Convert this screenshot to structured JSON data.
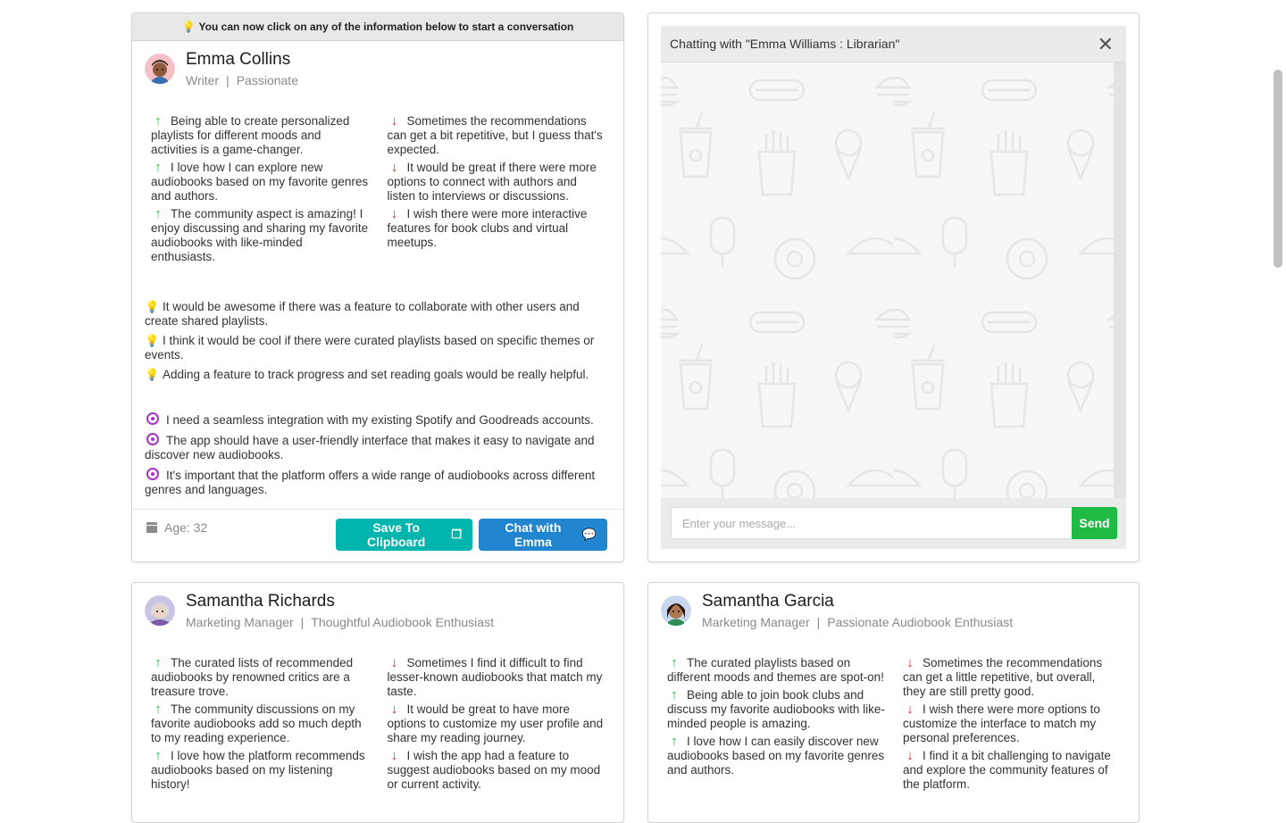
{
  "notice": "You can now click on any of the information below to start a conversation",
  "personas": [
    {
      "name": "Emma Collins",
      "role": "Writer",
      "trait": "Passionate",
      "likes": [
        "Being able to create personalized playlists for different moods and activities is a game-changer.",
        "I love how I can explore new audiobooks based on my favorite genres and authors.",
        "The community aspect is amazing! I enjoy discussing and sharing my favorite audiobooks with like-minded enthusiasts."
      ],
      "dislikes": [
        "Sometimes the recommendations can get a bit repetitive, but I guess that's expected.",
        "It would be great if there were more options to connect with authors and listen to interviews or discussions.",
        "I wish there were more interactive features for book clubs and virtual meetups."
      ],
      "suggestions": [
        "It would be awesome if there was a feature to collaborate with other users and create shared playlists.",
        "I think it would be cool if there were curated playlists based on specific themes or events.",
        "Adding a feature to track progress and set reading goals would be really helpful."
      ],
      "goals": [
        "I need a seamless integration with my existing Spotify and Goodreads accounts.",
        "The app should have a user-friendly interface that makes it easy to navigate and discover new audiobooks.",
        "It's important that the platform offers a wide range of audiobooks across different genres and languages."
      ],
      "age": "Age: 32",
      "copy_label": "Save To Clipboard",
      "chat_label": "Chat with Emma"
    },
    {
      "name": "Samantha Richards",
      "role": "Marketing Manager",
      "trait": "Thoughtful Audiobook Enthusiast",
      "likes": [
        "The curated lists of recommended audiobooks by renowned critics are a treasure trove.",
        "The community discussions on my favorite audiobooks add so much depth to my reading experience.",
        "I love how the platform recommends audiobooks based on my listening history!"
      ],
      "dislikes": [
        "Sometimes I find it difficult to find lesser-known audiobooks that match my taste.",
        "It would be great to have more options to customize my user profile and share my reading journey.",
        "I wish the app had a feature to suggest audiobooks based on my mood or current activity."
      ]
    },
    {
      "name": "Samantha Garcia",
      "role": "Marketing Manager",
      "trait": "Passionate Audiobook Enthusiast",
      "likes": [
        "The curated playlists based on different moods and themes are spot-on!",
        "Being able to join book clubs and discuss my favorite audiobooks with like-minded people is amazing.",
        "I love how I can easily discover new audiobooks based on my favorite genres and authors."
      ],
      "dislikes": [
        "Sometimes the recommendations can get a little repetitive, but overall, they are still pretty good.",
        "I wish there were more options to customize the interface to match my personal preferences.",
        "I find it a bit challenging to navigate and explore the community features of the platform."
      ]
    }
  ],
  "chat": {
    "title": "Chatting with \"Emma Williams : Librarian\"",
    "placeholder": "Enter your message...",
    "send_label": "Send"
  },
  "colors": {
    "like": "#21ba45",
    "dislike": "#db2828",
    "suggestion": "#fbbd08",
    "goal": "#a333c8",
    "copy_button": "#00b5ad",
    "chat_button": "#2185d0",
    "send_button": "#21ba45"
  }
}
